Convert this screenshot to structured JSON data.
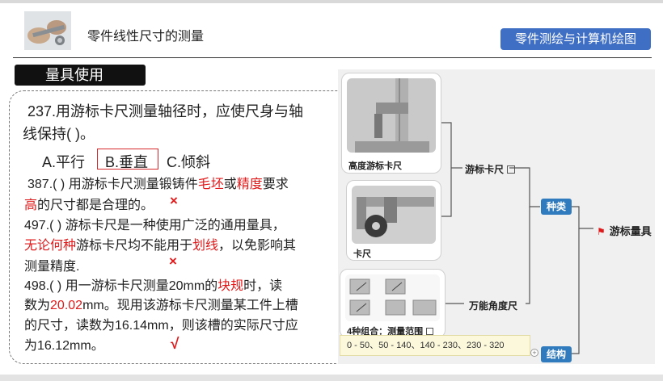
{
  "header": {
    "title": "零件线性尺寸的测量",
    "course_badge": "零件测绘与计算机绘图"
  },
  "section_tab": "量具使用",
  "questions": {
    "q237": {
      "line1": "237.用游标卡尺测量轴径时，应使尺身与轴",
      "line2": "线保持(   )。",
      "option_a": "A.平行",
      "option_b": "B.垂直",
      "option_c": "C.倾斜"
    },
    "q387": {
      "p1": "387.(   ) 用游标卡尺测量锻铸件",
      "r1": "毛坯",
      "p2": "或",
      "r2": "精度",
      "p3": "要求",
      "r3": "高",
      "p4": "的尺寸都是合理的。",
      "mark": "×"
    },
    "q497": {
      "line1": "497.(    ) 游标卡尺是一种使用广泛的通用量具，",
      "r1": "无论何种",
      "p2": "游标卡尺均不能用于",
      "r2": "划线",
      "p3": "，以免影响其",
      "line3": "测量精度.",
      "mark": "×"
    },
    "q498": {
      "p1": "498.(    ) 用一游标卡尺测量20mm的",
      "r1": "块规",
      "p2": "时，读",
      "p3": "数为",
      "r2": "20.02",
      "p4": "mm。现用该游标卡尺测量某工件上槽",
      "line3": "的尺寸，读数为16.14mm，则该槽的实际尺寸应",
      "line4": "为16.12mm。",
      "mark": "√"
    }
  },
  "mindmap": {
    "root": "游标量具",
    "branch_types": "种类",
    "branch_structure": "结构",
    "node_vernier": "游标卡尺",
    "node_angle": "万能角度尺",
    "card_height": "高度游标卡尺",
    "card_caliper": "卡尺",
    "card_combo": "4种组合：测量范围",
    "tooltip": "0 - 50、50 - 140、140 - 230、230 - 320"
  },
  "colors": {
    "accent_blue": "#3f6fc4",
    "node_blue": "#2f7bbd",
    "highlight_red": "#e0191a"
  }
}
